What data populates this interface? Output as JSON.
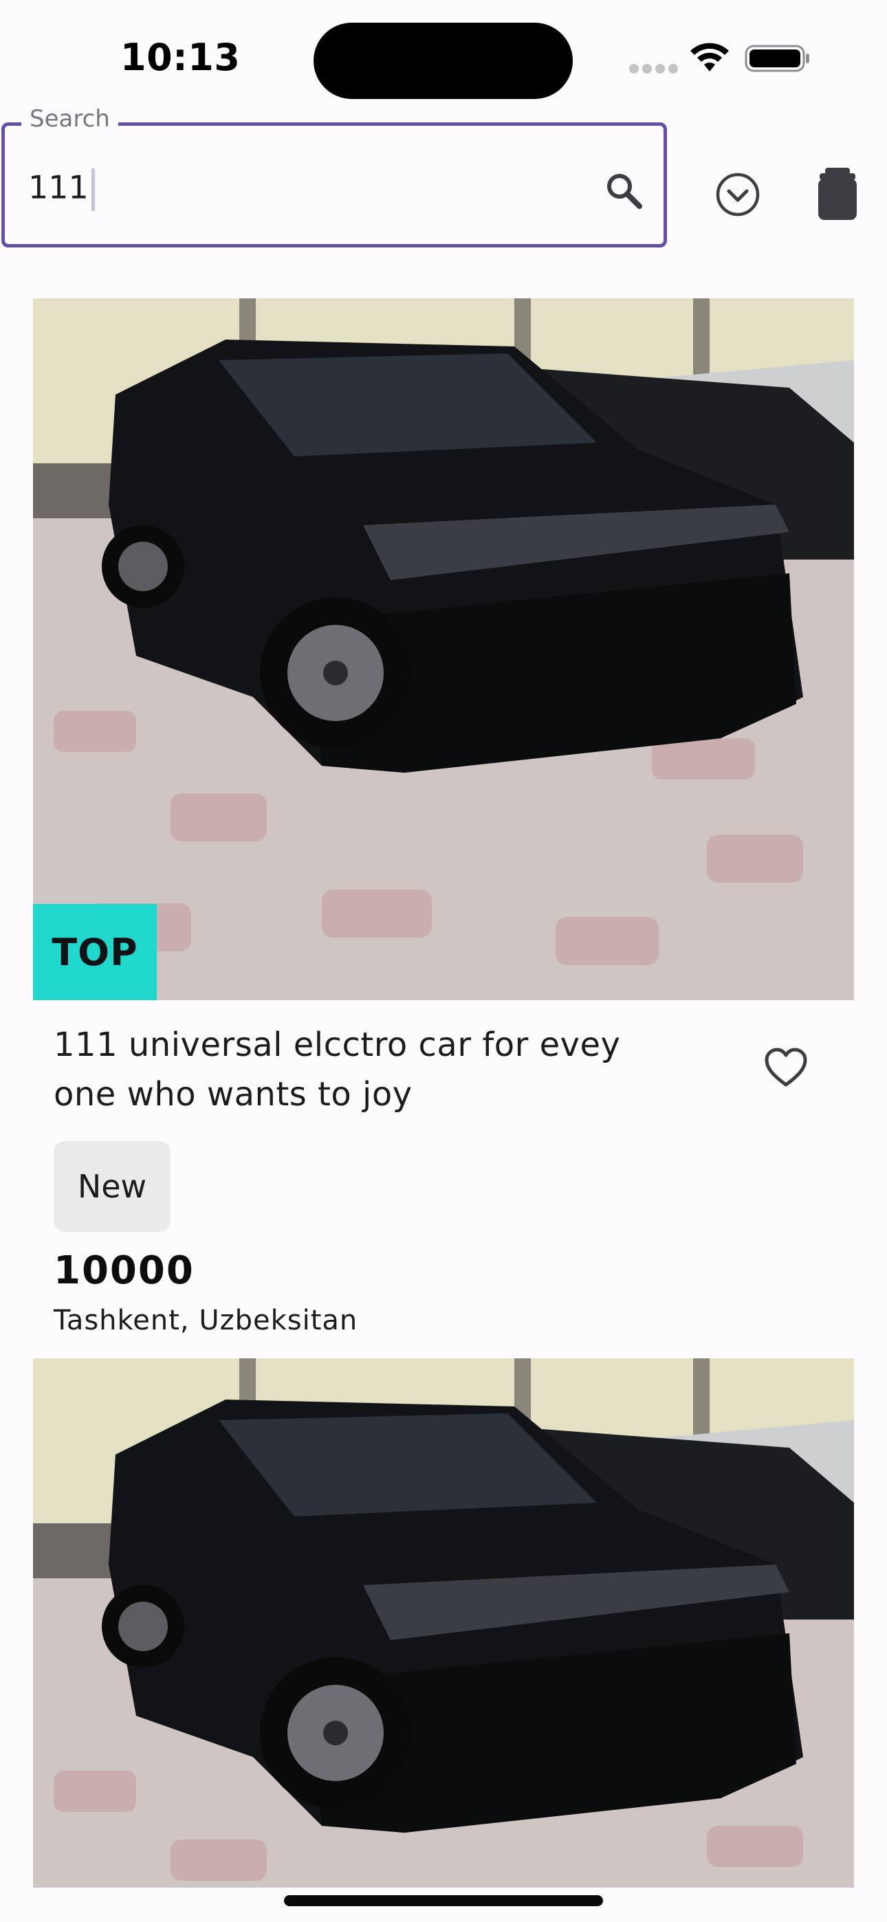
{
  "status_bar": {
    "time": "10:13"
  },
  "search": {
    "label": "Search",
    "value": "111",
    "search_icon": "search-icon",
    "filter_icon": "chevron-down-circle-icon",
    "clear_icon": "trash-icon"
  },
  "listings": [
    {
      "badge": "TOP",
      "title": "111 universal elcctro car for evey one who wants to joy",
      "condition": "New",
      "price": "10000",
      "location": "Tashkent, Uzbeksitan",
      "favorite_icon": "heart-outline-icon"
    },
    {
      "image": "car-photo"
    }
  ],
  "colors": {
    "accent": "#6750a4",
    "badge_bg": "#1fd7cb",
    "chip_bg": "#ece9ea",
    "background": "#fefbff"
  }
}
